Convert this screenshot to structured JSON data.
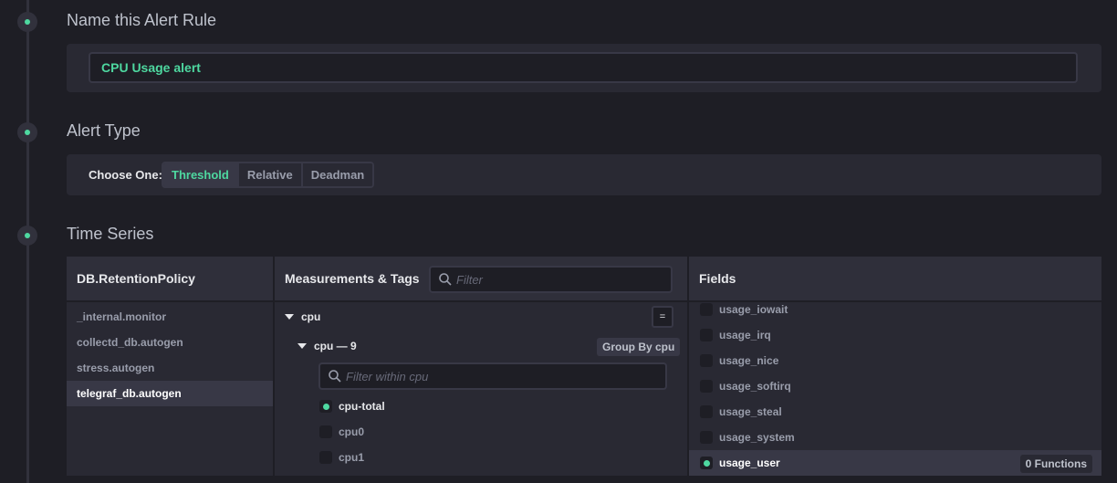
{
  "steps": {
    "name": {
      "heading": "Name this Alert Rule",
      "value": "CPU Usage alert"
    },
    "type": {
      "heading": "Alert Type",
      "choose_label": "Choose One:",
      "options": [
        "Threshold",
        "Relative",
        "Deadman"
      ],
      "selected": "Threshold"
    },
    "series": {
      "heading": "Time Series"
    }
  },
  "databases": {
    "header": "DB.RetentionPolicy",
    "items": [
      "_internal.monitor",
      "collectd_db.autogen",
      "stress.autogen",
      "telegraf_db.autogen"
    ],
    "selected": "telegraf_db.autogen"
  },
  "measurements": {
    "header": "Measurements & Tags",
    "filter_placeholder": "Filter",
    "root": "cpu",
    "equals_button": "=",
    "tag_key": "cpu — 9",
    "group_by": "Group By cpu",
    "tag_filter_placeholder": "Filter within cpu",
    "tag_values": [
      {
        "label": "cpu-total",
        "checked": true
      },
      {
        "label": "cpu0",
        "checked": false
      },
      {
        "label": "cpu1",
        "checked": false
      }
    ]
  },
  "fields": {
    "header": "Fields",
    "items": [
      {
        "label": "usage_iowait",
        "checked": false
      },
      {
        "label": "usage_irq",
        "checked": false
      },
      {
        "label": "usage_nice",
        "checked": false
      },
      {
        "label": "usage_softirq",
        "checked": false
      },
      {
        "label": "usage_steal",
        "checked": false
      },
      {
        "label": "usage_system",
        "checked": false
      },
      {
        "label": "usage_user",
        "checked": true
      }
    ],
    "functions_label": "0 Functions"
  },
  "colors": {
    "accent": "#4ed8a0",
    "background": "#1e1e25",
    "panel": "#292933"
  }
}
